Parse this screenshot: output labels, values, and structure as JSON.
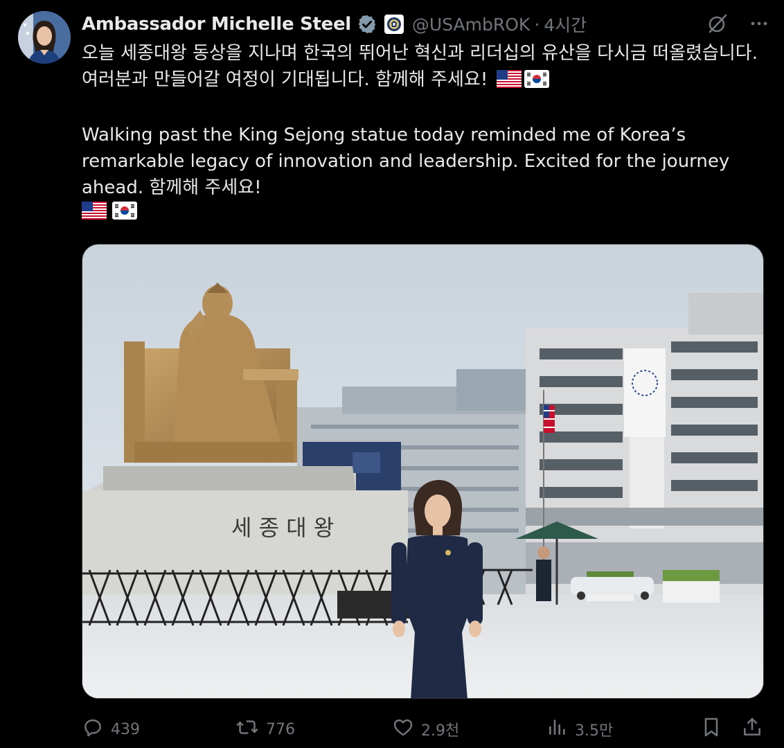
{
  "author": {
    "display_name": "Ambassador Michelle Steel",
    "handle": "@USAmbROK",
    "separator": "·",
    "time": "4시간"
  },
  "icons": {
    "verified": "verified-badge-icon",
    "affiliation": "embassy-seal-icon",
    "grok": "grok-icon",
    "more": "more-icon",
    "reply": "reply-icon",
    "retweet": "retweet-icon",
    "like": "heart-icon",
    "views": "views-chart-icon",
    "bookmark": "bookmark-icon",
    "share": "share-icon"
  },
  "tweet": {
    "korean_line1": "오늘 세종대왕 동상을 지나며 한국의 뛰어난 혁신과 리더십의 유산을 다시금 떠올렸습니다.",
    "korean_line2": "여러분과 만들어갈 여정이 기대됩니다. 함께해 주세요!",
    "english_line1": "Walking past the King Sejong statue today reminded me of Korea’s",
    "english_line2": "remarkable legacy of innovation and leadership. Excited for the journey",
    "english_line3": "ahead. 함께해 주세요!"
  },
  "media": {
    "statue_inscription": "세 종 대 왕"
  },
  "actions": {
    "replies": "439",
    "retweets": "776",
    "likes": "2.9천",
    "views": "3.5만"
  },
  "colors": {
    "background": "#000000",
    "text": "#e7e9ea",
    "secondary": "#71767b",
    "verified": "#829aab"
  }
}
